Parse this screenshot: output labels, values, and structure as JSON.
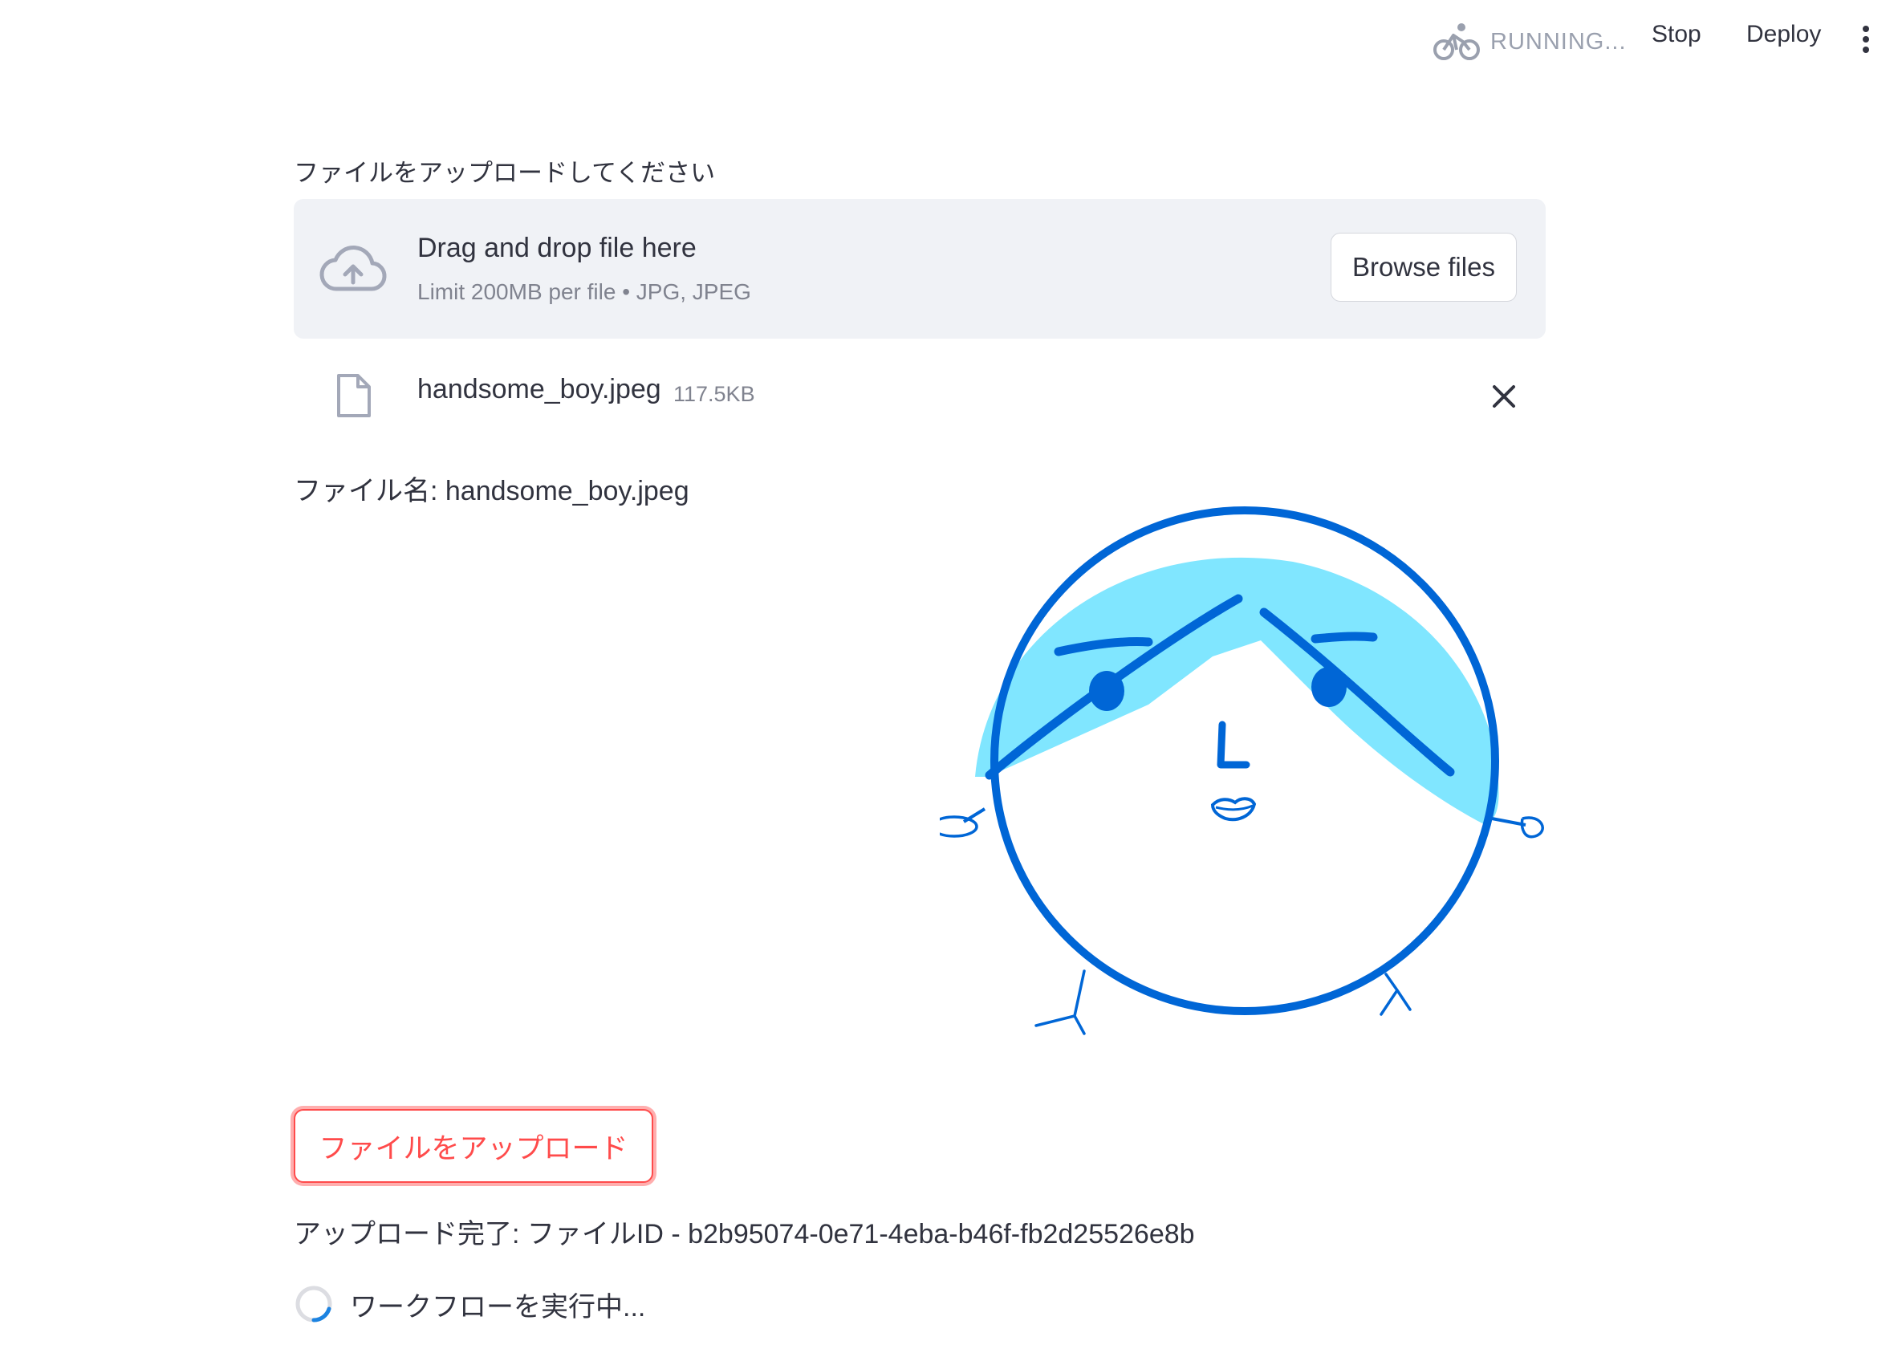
{
  "header": {
    "status_text": "RUNNING...",
    "stop_label": "Stop",
    "deploy_label": "Deploy",
    "status_icon": "bicycle-icon",
    "menu_icon": "more-vertical-icon"
  },
  "uploader": {
    "label": "ファイルをアップロードしてください",
    "drop_title": "Drag and drop file here",
    "drop_subtitle": "Limit 200MB per file • JPG, JPEG",
    "browse_label": "Browse files",
    "upload_icon": "cloud-upload-icon"
  },
  "uploaded_file": {
    "name": "handsome_boy.jpeg",
    "size": "117.5KB",
    "file_icon": "file-icon",
    "remove_icon": "close-icon"
  },
  "file_name_line": "ファイル名: handsome_boy.jpeg",
  "upload_button_label": "ファイルをアップロード",
  "complete_line": "アップロード完了: ファイルID - b2b95074-0e71-4eba-b46f-fb2d25526e8b",
  "running_text": "ワークフローを実行中...",
  "colors": {
    "accent_red": "#ff4b4b",
    "dropzone_bg": "#f0f2f6",
    "drawing_blue": "#0066d6",
    "drawing_fill": "#80e6ff"
  }
}
